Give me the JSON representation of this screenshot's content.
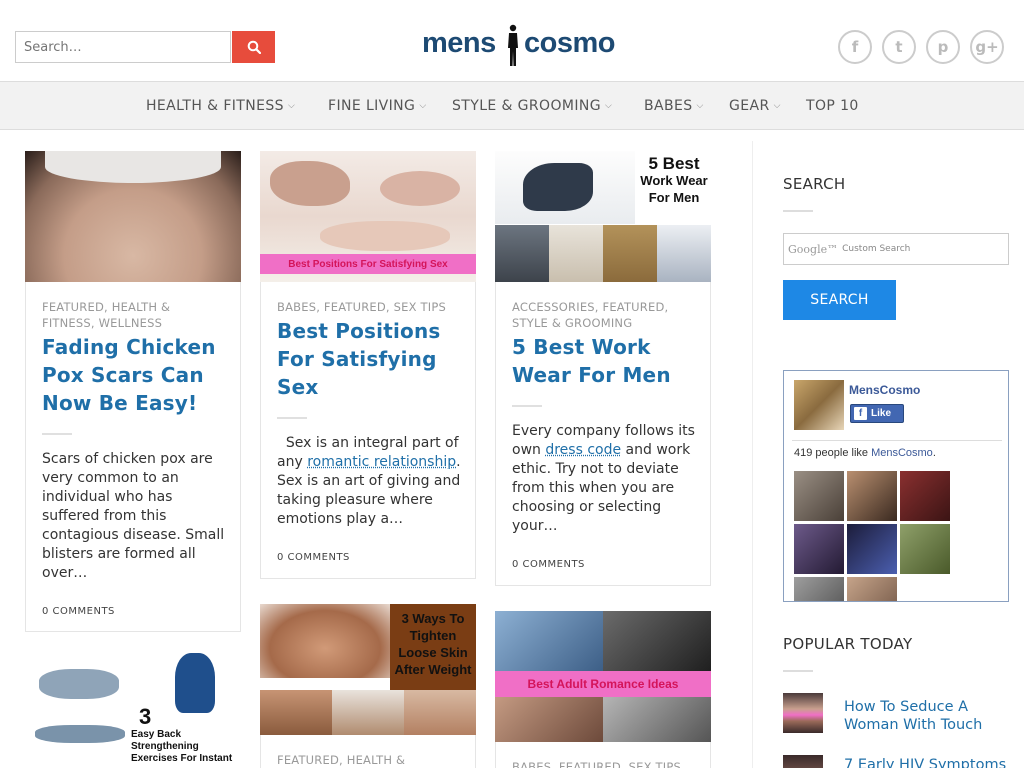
{
  "header": {
    "search_placeholder": "Search…",
    "logo_left": "mens",
    "logo_right": "cosmo",
    "social": [
      {
        "icon": "facebook-icon",
        "glyph": "f"
      },
      {
        "icon": "twitter-icon",
        "glyph": "t"
      },
      {
        "icon": "pinterest-icon",
        "glyph": "p"
      },
      {
        "icon": "google-plus-icon",
        "glyph": "g+"
      }
    ]
  },
  "nav": {
    "items": [
      "HEALTH & FITNESS",
      "FINE LIVING",
      "STYLE & GROOMING",
      "BABES",
      "GEAR",
      "TOP 10"
    ],
    "chevron": "⌵"
  },
  "posts": [
    {
      "categories": [
        "FEATURED",
        "HEALTH & FITNESS",
        "WELLNESS"
      ],
      "cat_line1": "FEATURED, HEALTH &",
      "cat_line2": "FITNESS, WELLNESS",
      "title_lines": [
        "Fading Chicken",
        "Pox Scars Can",
        "Now Be Easy!"
      ],
      "excerpt": "Scars of chicken pox are very common to an individual who has suffered from this contagious disease. Small blisters are formed all over…",
      "comments": "0 COMMENTS"
    },
    {
      "cat_line1": "BABES, FEATURED, SEX TIPS",
      "title_lines": [
        "Best Positions",
        "For Satisfying",
        "Sex"
      ],
      "thumb_caption": "Best Positions For Satisfying Sex",
      "excerpt_pre": "  Sex is an integral part of any ",
      "excerpt_link": "romantic relationship",
      "excerpt_post": ". Sex is an art of giving and taking pleasure where emotions play a…",
      "comments": "0 COMMENTS"
    },
    {
      "cat_line1": "ACCESSORIES, FEATURED,",
      "cat_line2": "STYLE & GROOMING",
      "title_lines": [
        "5 Best Work",
        "Wear For Men"
      ],
      "thumb_caption_lines": [
        "5 Best",
        "Work Wear",
        "For Men"
      ],
      "excerpt_pre": "Every company follows its own ",
      "excerpt_link": "dress code",
      "excerpt_post": " and work ethic. Try not to deviate from this when you are choosing or selecting your…",
      "comments": "0 COMMENTS"
    },
    {
      "thumb_caption_lines": [
        "3",
        "Easy Back",
        "Strengthening",
        "Exercises For Instant"
      ]
    },
    {
      "cat_line1": "FEATURED, HEALTH &",
      "thumb_caption_lines": [
        "3 Ways To",
        "Tighten",
        "Loose Skin",
        "After Weight"
      ]
    },
    {
      "cat_line1": "BABES, FEATURED, SEX TIPS",
      "thumb_caption": "Best Adult Romance Ideas"
    }
  ],
  "sidebar": {
    "search_heading": "SEARCH",
    "google_label": "Google™",
    "custom_search": "Custom Search",
    "search_button": "SEARCH",
    "fb": {
      "page_name": "MensCosmo",
      "like_label": "Like",
      "count_prefix": "419 people like ",
      "count_page": "MensCosmo",
      "count_suffix": "."
    },
    "popular_heading": "POPULAR TODAY",
    "popular": [
      {
        "title": "How To Seduce A Woman With Touch"
      },
      {
        "title": "7 Early HIV Symptoms"
      }
    ]
  }
}
